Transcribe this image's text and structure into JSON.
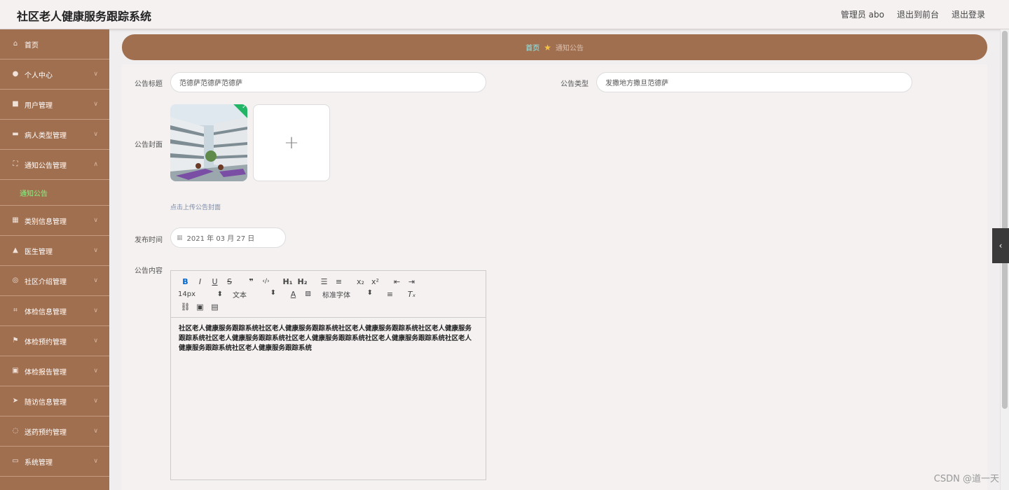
{
  "header": {
    "title": "社区老人健康服务跟踪系统",
    "user": "管理员 abo",
    "front_link": "退出到前台",
    "logout": "退出登录"
  },
  "sidebar": {
    "items": [
      {
        "label": "首页",
        "icon": "home-icon"
      },
      {
        "label": "个人中心",
        "icon": "user-icon"
      },
      {
        "label": "用户管理",
        "icon": "video-icon"
      },
      {
        "label": "病人类型管理",
        "icon": "monitor-icon"
      },
      {
        "label": "通知公告管理",
        "icon": "frame-icon"
      },
      {
        "label": "类别信息管理",
        "icon": "grid-icon"
      },
      {
        "label": "医生管理",
        "icon": "thumb-icon"
      },
      {
        "label": "社区介绍管理",
        "icon": "compass-icon"
      },
      {
        "label": "体检信息管理",
        "icon": "crop-icon"
      },
      {
        "label": "体检预约管理",
        "icon": "flag-icon"
      },
      {
        "label": "体检报告管理",
        "icon": "clipboard-icon"
      },
      {
        "label": "随访信息管理",
        "icon": "send-icon"
      },
      {
        "label": "送药预约管理",
        "icon": "loading-icon"
      },
      {
        "label": "系统管理",
        "icon": "chat-icon"
      }
    ],
    "submenu": "通知公告"
  },
  "breadcrumb": {
    "home": "首页",
    "current": "通知公告"
  },
  "form": {
    "title_label": "公告标题",
    "title_value": "范德萨范德萨范德萨",
    "type_label": "公告类型",
    "type_value": "发撒地方撒旦范德萨",
    "cover_label": "公告封面",
    "upload_hint": "点击上传公告封面",
    "time_label": "发布时间",
    "time_value": "2021 年 03 月 27 日",
    "content_label": "公告内容"
  },
  "editor": {
    "font_size": "14px",
    "block_type": "文本",
    "font_family": "标准字体",
    "content": "社区老人健康服务跟踪系统社区老人健康服务跟踪系统社区老人健康服务跟踪系统社区老人健康服务跟踪系统社区老人健康服务跟踪系统社区老人健康服务跟踪系统社区老人健康服务跟踪系统社区老人健康服务跟踪系统社区老人健康服务跟踪系统"
  },
  "watermark": "CSDN @道一天",
  "colors": {
    "sidebar": "#a06f50",
    "active_sub": "#8cf083",
    "breadcrumb_home": "#8ff0f4"
  }
}
